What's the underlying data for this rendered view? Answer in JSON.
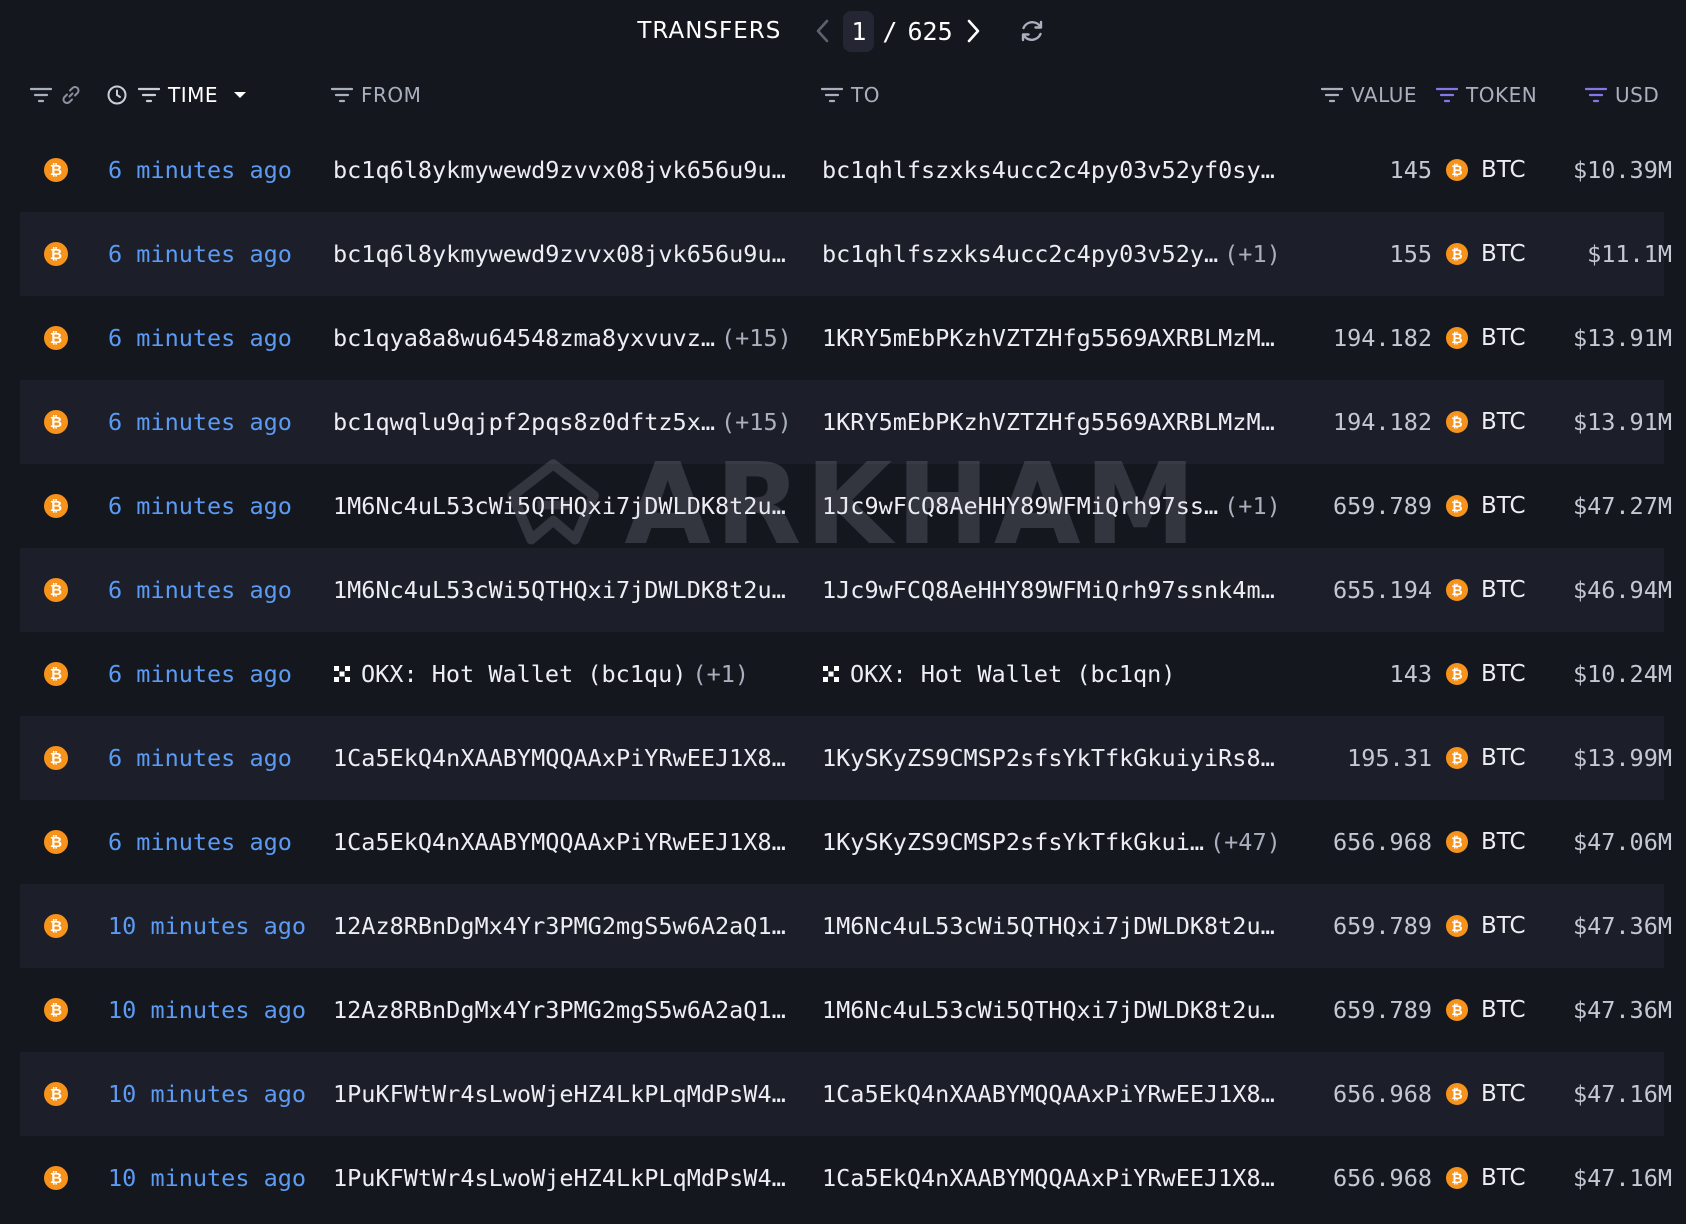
{
  "toolbar": {
    "title": "TRANSFERS",
    "page_current": "1",
    "page_separator": "/",
    "page_total": "625"
  },
  "header": {
    "time": "TIME",
    "from": "FROM",
    "to": "TO",
    "value": "VALUE",
    "token": "TOKEN",
    "usd": "USD"
  },
  "watermark": "ARKHAM",
  "rows": [
    {
      "time": "6 minutes ago",
      "from": "bc1q6l8ykmywewd9zvvx08jvk656u9u…",
      "from_extra": "",
      "to": "bc1qhlfszxks4ucc2c4py03v52yf0sy…",
      "to_extra": "",
      "value": "145",
      "token": "BTC",
      "usd": "$10.39M"
    },
    {
      "time": "6 minutes ago",
      "from": "bc1q6l8ykmywewd9zvvx08jvk656u9u…",
      "from_extra": "",
      "to": "bc1qhlfszxks4ucc2c4py03v52y…",
      "to_extra": "(+1)",
      "value": "155",
      "token": "BTC",
      "usd": "$11.1M"
    },
    {
      "time": "6 minutes ago",
      "from": "bc1qya8a8wu64548zma8yxvuvz…",
      "from_extra": "(+15)",
      "to": "1KRY5mEbPKzhVZTZHfg5569AXRBLMzM…",
      "to_extra": "",
      "value": "194.182",
      "token": "BTC",
      "usd": "$13.91M"
    },
    {
      "time": "6 minutes ago",
      "from": "bc1qwqlu9qjpf2pqs8z0dftz5x…",
      "from_extra": "(+15)",
      "to": "1KRY5mEbPKzhVZTZHfg5569AXRBLMzM…",
      "to_extra": "",
      "value": "194.182",
      "token": "BTC",
      "usd": "$13.91M"
    },
    {
      "time": "6 minutes ago",
      "from": "1M6Nc4uL53cWi5QTHQxi7jDWLDK8t2u…",
      "from_extra": "",
      "to": "1Jc9wFCQ8AeHHY89WFMiQrh97ss…",
      "to_extra": "(+1)",
      "value": "659.789",
      "token": "BTC",
      "usd": "$47.27M"
    },
    {
      "time": "6 minutes ago",
      "from": "1M6Nc4uL53cWi5QTHQxi7jDWLDK8t2u…",
      "from_extra": "",
      "to": "1Jc9wFCQ8AeHHY89WFMiQrh97ssnk4m…",
      "to_extra": "",
      "value": "655.194",
      "token": "BTC",
      "usd": "$46.94M"
    },
    {
      "time": "6 minutes ago",
      "from": "OKX: Hot Wallet (bc1qu)",
      "from_extra": "(+1)",
      "from_icon": "okx-icon",
      "to": "OKX: Hot Wallet (bc1qn)",
      "to_extra": "",
      "to_icon": "okx-icon",
      "value": "143",
      "token": "BTC",
      "usd": "$10.24M"
    },
    {
      "time": "6 minutes ago",
      "from": "1Ca5EkQ4nXAABYMQQAAxPiYRwEEJ1X8…",
      "from_extra": "",
      "to": "1KySKyZS9CMSP2sfsYkTfkGkuiyiRs8…",
      "to_extra": "",
      "value": "195.31",
      "token": "BTC",
      "usd": "$13.99M"
    },
    {
      "time": "6 minutes ago",
      "from": "1Ca5EkQ4nXAABYMQQAAxPiYRwEEJ1X8…",
      "from_extra": "",
      "to": "1KySKyZS9CMSP2sfsYkTfkGkui…",
      "to_extra": "(+47)",
      "value": "656.968",
      "token": "BTC",
      "usd": "$47.06M"
    },
    {
      "time": "10 minutes ago",
      "from": "12Az8RBnDgMx4Yr3PMG2mgS5w6A2aQ1…",
      "from_extra": "",
      "to": "1M6Nc4uL53cWi5QTHQxi7jDWLDK8t2u…",
      "to_extra": "",
      "value": "659.789",
      "token": "BTC",
      "usd": "$47.36M"
    },
    {
      "time": "10 minutes ago",
      "from": "12Az8RBnDgMx4Yr3PMG2mgS5w6A2aQ1…",
      "from_extra": "",
      "to": "1M6Nc4uL53cWi5QTHQxi7jDWLDK8t2u…",
      "to_extra": "",
      "value": "659.789",
      "token": "BTC",
      "usd": "$47.36M"
    },
    {
      "time": "10 minutes ago",
      "from": "1PuKFWtWr4sLwoWjeHZ4LkPLqMdPsW4…",
      "from_extra": "",
      "to": "1Ca5EkQ4nXAABYMQQAAxPiYRwEEJ1X8…",
      "to_extra": "",
      "value": "656.968",
      "token": "BTC",
      "usd": "$47.16M"
    },
    {
      "time": "10 minutes ago",
      "from": "1PuKFWtWr4sLwoWjeHZ4LkPLqMdPsW4…",
      "from_extra": "",
      "to": "1Ca5EkQ4nXAABYMQQAAxPiYRwEEJ1X8…",
      "to_extra": "",
      "value": "656.968",
      "token": "BTC",
      "usd": "$47.16M"
    }
  ]
}
